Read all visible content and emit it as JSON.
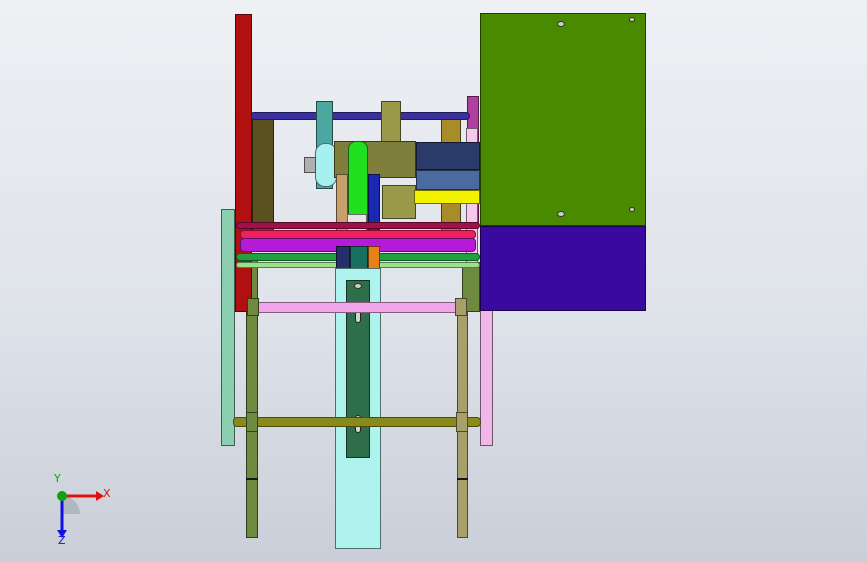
{
  "app": {
    "view": "cad-3d-assembly"
  },
  "colors": {
    "background_top": "#eef0f4",
    "background_bottom": "#c9ced8",
    "left_red_frame": "#b01010",
    "right_green_box": "#4a8a00",
    "right_blue_box": "#3a0aa0",
    "bottom_cyan_plate": "#aef3ee",
    "dark_green_slide": "#2e6e4a",
    "pink_rod": "#f2a6ea",
    "olive_rod": "#8a8a1a"
  },
  "triad": {
    "x_label": "X",
    "y_label": "Y",
    "z_label": "Z",
    "x_color": "#e01010",
    "y_color": "#10a010",
    "z_color": "#1010e0"
  }
}
